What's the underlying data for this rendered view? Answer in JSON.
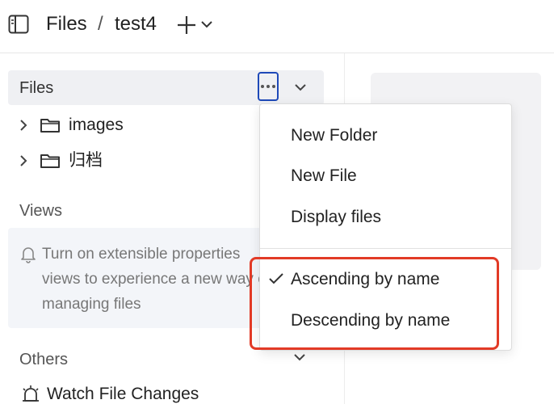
{
  "header": {
    "breadcrumb": [
      "Files",
      "test4"
    ],
    "separator": "/"
  },
  "sidebar": {
    "files_title": "Files",
    "tree": [
      {
        "label": "images"
      },
      {
        "label": "归档"
      }
    ],
    "views_title": "Views",
    "views_notice": [
      "Turn on extensible properties",
      "views to experience a new way of",
      "managing files"
    ],
    "others_title": "Others",
    "watch_label": "Watch File Changes"
  },
  "menu": {
    "items": [
      "New Folder",
      "New File",
      "Display files"
    ],
    "sort_items": [
      {
        "label": "Ascending by name",
        "checked": true
      },
      {
        "label": "Descending by name",
        "checked": false
      }
    ]
  },
  "colors": {
    "focus_outline": "#1e49b8",
    "annotation_red": "#e23a26"
  }
}
